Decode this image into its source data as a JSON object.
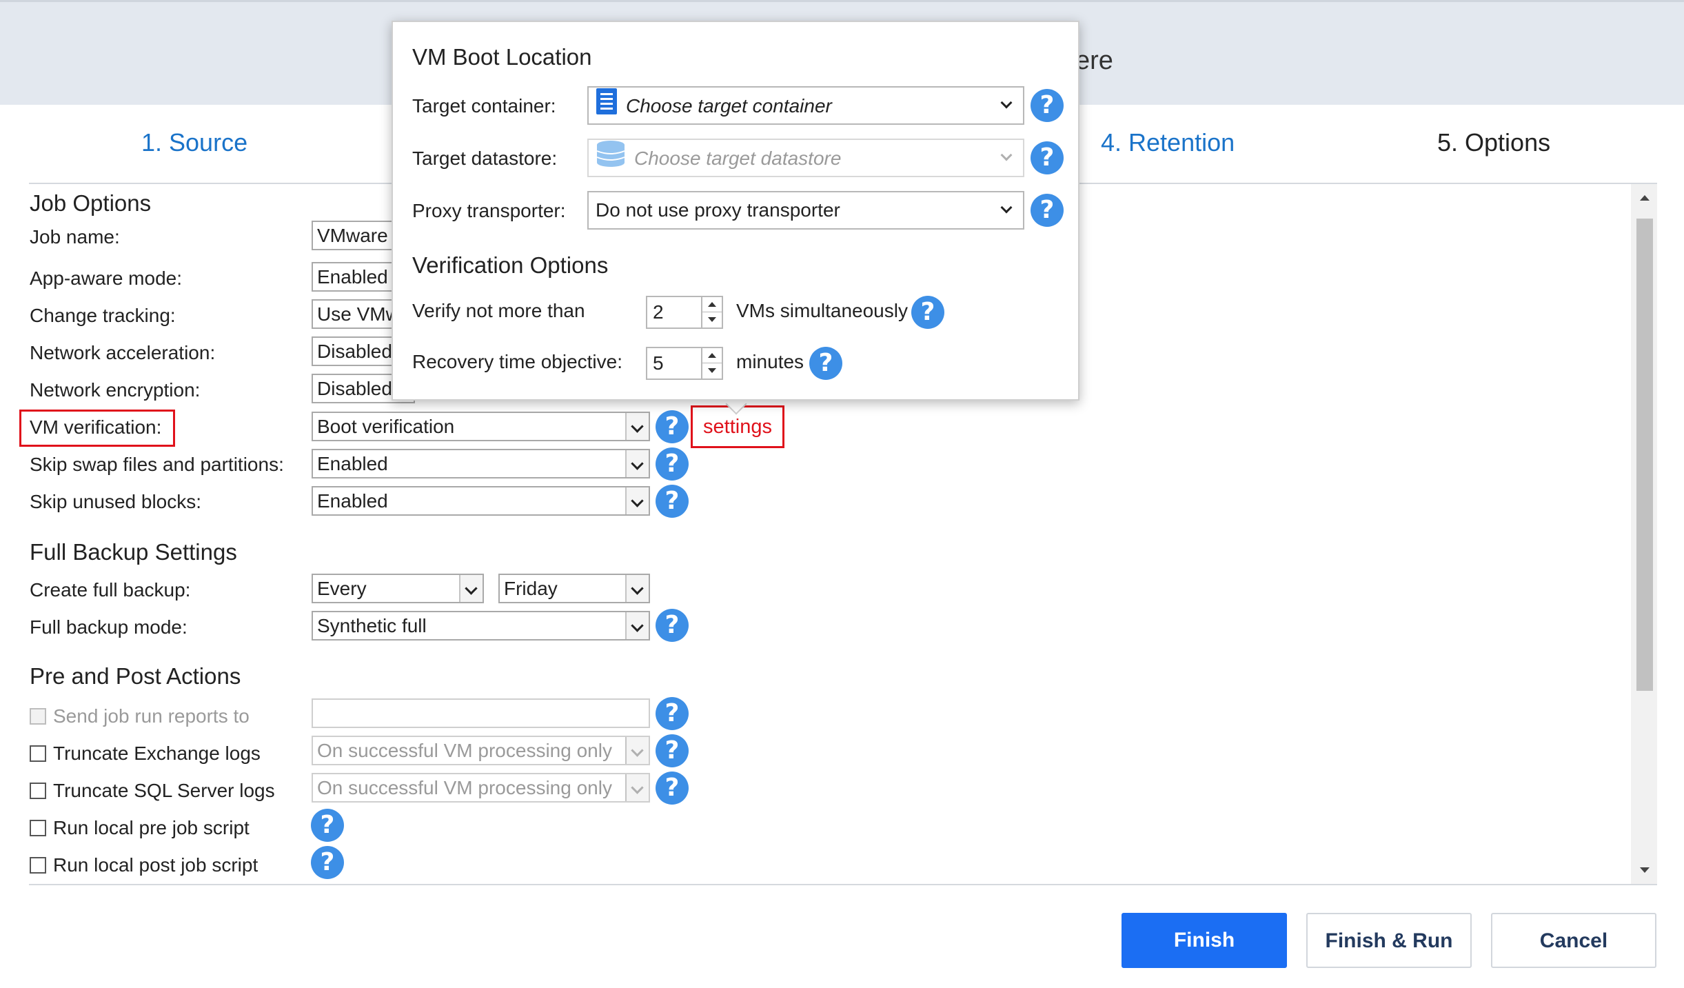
{
  "header": {
    "title_fragment": "ere"
  },
  "steps": [
    {
      "label": "1. Source",
      "state": "link"
    },
    {
      "label": "4. Retention",
      "state": "link"
    },
    {
      "label": "5. Options",
      "state": "active"
    }
  ],
  "job_options": {
    "title": "Job Options",
    "job_name": {
      "label": "Job name:",
      "value": "VMware"
    },
    "app_aware": {
      "label": "App-aware mode:",
      "value": "Enabled"
    },
    "change_tracking": {
      "label": "Change tracking:",
      "value": "Use VMw"
    },
    "network_acceleration": {
      "label": "Network acceleration:",
      "value": "Disabled"
    },
    "network_encryption": {
      "label": "Network encryption:",
      "value": "Disabled"
    },
    "vm_verification": {
      "label": "VM verification:",
      "value": "Boot verification",
      "settings_link": "settings"
    },
    "skip_swap": {
      "label": "Skip swap files and partitions:",
      "value": "Enabled"
    },
    "skip_unused": {
      "label": "Skip unused blocks:",
      "value": "Enabled"
    }
  },
  "full_backup": {
    "title": "Full Backup Settings",
    "create": {
      "label": "Create full backup:",
      "frequency": "Every",
      "day": "Friday"
    },
    "mode": {
      "label": "Full backup mode:",
      "value": "Synthetic full"
    }
  },
  "pre_post": {
    "title": "Pre and Post Actions",
    "send_reports": {
      "label": "Send job run reports to",
      "value": "",
      "checked": false,
      "enabled": false
    },
    "truncate_exchange": {
      "label": "Truncate Exchange logs",
      "value": "On successful VM processing only",
      "checked": false
    },
    "truncate_sql": {
      "label": "Truncate SQL Server logs",
      "value": "On successful VM processing only",
      "checked": false
    },
    "pre_script": {
      "label": "Run local pre job script",
      "checked": false
    },
    "post_script": {
      "label": "Run local post job script",
      "checked": false
    }
  },
  "help_glyph": "?",
  "popup": {
    "boot_title": "VM Boot Location",
    "target_container": {
      "label": "Target container:",
      "placeholder": "Choose target container",
      "icon": "container-icon"
    },
    "target_datastore": {
      "label": "Target datastore:",
      "placeholder": "Choose target datastore",
      "icon": "datastore-icon",
      "enabled": false
    },
    "proxy": {
      "label": "Proxy transporter:",
      "value": "Do not use proxy transporter"
    },
    "verification_title": "Verification Options",
    "verify_max": {
      "label": "Verify not more than",
      "value": "2",
      "suffix": "VMs simultaneously"
    },
    "rto": {
      "label": "Recovery time objective:",
      "value": "5",
      "suffix": "minutes"
    }
  },
  "footer": {
    "finish": "Finish",
    "finish_run": "Finish & Run",
    "cancel": "Cancel"
  },
  "colors": {
    "accent": "#1b6ef3",
    "link": "#1a73c9",
    "help": "#3d8fe6",
    "highlight": "#e0121b"
  }
}
